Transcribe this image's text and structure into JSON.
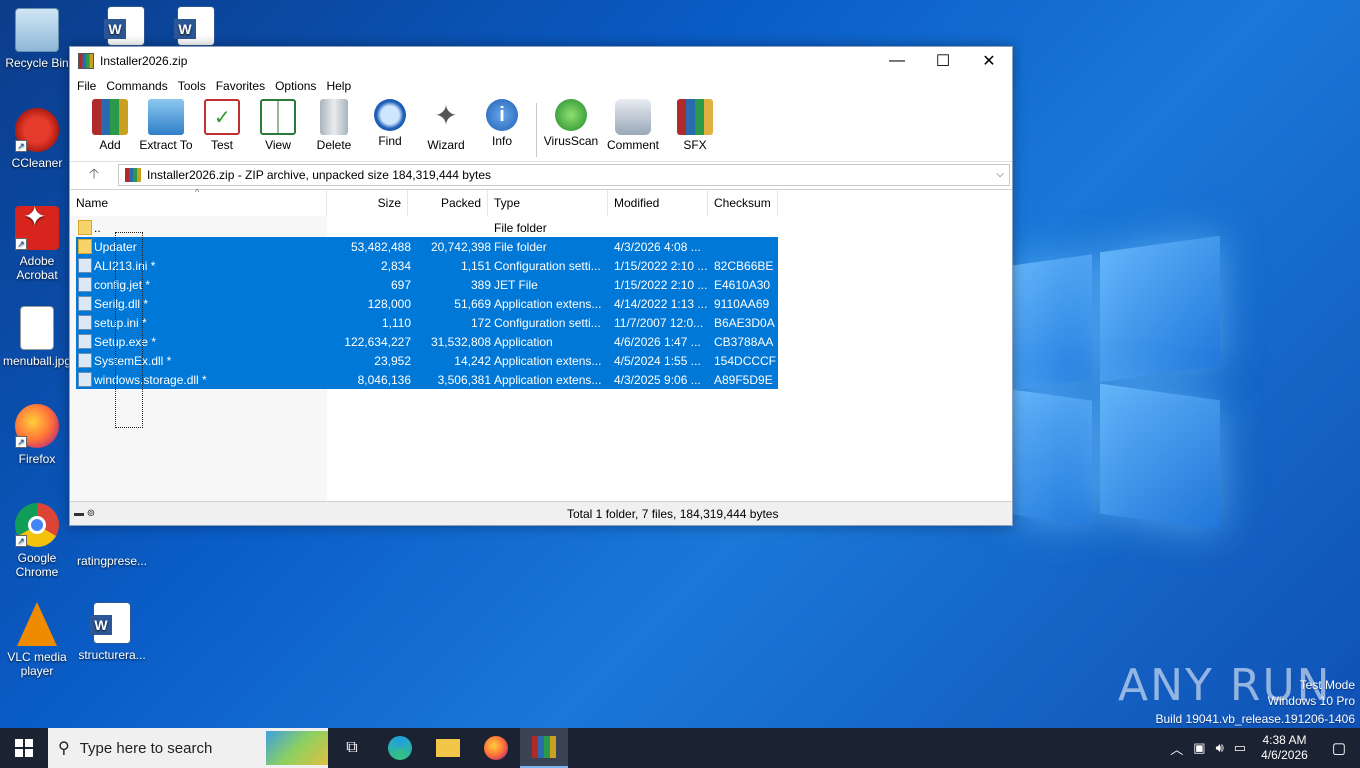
{
  "desktop": {
    "icons": [
      {
        "label": "Recycle Bin"
      },
      {
        "label": "CCleaner"
      },
      {
        "label": "Adobe Acrobat"
      },
      {
        "label": "menuball.jpg"
      },
      {
        "label": "Firefox"
      },
      {
        "label": "Google Chrome"
      },
      {
        "label": "ratingprese..."
      },
      {
        "label": "VLC media player"
      },
      {
        "label": "structurera..."
      }
    ]
  },
  "window": {
    "title": "Installer2026.zip",
    "controls": {
      "minimize": "—",
      "maximize": "☐",
      "close": "✕"
    },
    "menu": [
      "File",
      "Commands",
      "Tools",
      "Favorites",
      "Options",
      "Help"
    ],
    "toolbar": [
      "Add",
      "Extract To",
      "Test",
      "View",
      "Delete",
      "Find",
      "Wizard",
      "Info",
      "VirusScan",
      "Comment",
      "SFX"
    ],
    "address": "Installer2026.zip - ZIP archive, unpacked size 184,319,444 bytes",
    "columns": [
      "Name",
      "Size",
      "Packed",
      "Type",
      "Modified",
      "Checksum"
    ],
    "rows": [
      {
        "name": "..",
        "size": "",
        "packed": "",
        "type": "File folder",
        "modified": "",
        "checksum": "",
        "selected": false,
        "folder": true
      },
      {
        "name": "Updater",
        "size": "53,482,488",
        "packed": "20,742,398",
        "type": "File folder",
        "modified": "4/3/2026 4:08 ...",
        "checksum": "",
        "selected": true,
        "folder": true
      },
      {
        "name": "ALI213.ini *",
        "size": "2,834",
        "packed": "1,151",
        "type": "Configuration setti...",
        "modified": "1/15/2022 2:10 ...",
        "checksum": "82CB66BE",
        "selected": true,
        "folder": false
      },
      {
        "name": "config.jet *",
        "size": "697",
        "packed": "389",
        "type": "JET File",
        "modified": "1/15/2022 2:10 ...",
        "checksum": "E4610A30",
        "selected": true,
        "folder": false
      },
      {
        "name": "Serilg.dll *",
        "size": "128,000",
        "packed": "51,669",
        "type": "Application extens...",
        "modified": "4/14/2022 1:13 ...",
        "checksum": "9110AA69",
        "selected": true,
        "folder": false
      },
      {
        "name": "setup.ini *",
        "size": "1,110",
        "packed": "172",
        "type": "Configuration setti...",
        "modified": "11/7/2007 12:0...",
        "checksum": "B6AE3D0A",
        "selected": true,
        "folder": false
      },
      {
        "name": "Setup.exe *",
        "size": "122,634,227",
        "packed": "31,532,808",
        "type": "Application",
        "modified": "4/6/2026 1:47 ...",
        "checksum": "CB3788AA",
        "selected": true,
        "folder": false
      },
      {
        "name": "SystemEx.dll *",
        "size": "23,952",
        "packed": "14,242",
        "type": "Application extens...",
        "modified": "4/5/2024 1:55 ...",
        "checksum": "154DCCCF",
        "selected": true,
        "folder": false
      },
      {
        "name": "windows.storage.dll *",
        "size": "8,046,136",
        "packed": "3,506,381",
        "type": "Application extens...",
        "modified": "4/3/2025 9:06 ...",
        "checksum": "A89F5D9E",
        "selected": true,
        "folder": false
      }
    ],
    "status": "Total 1 folder, 7 files, 184,319,444 bytes"
  },
  "watermark": {
    "line1": "Test Mode",
    "line2": "Windows 10 Pro",
    "line3": "Build 19041.vb_release.191206-1406",
    "brand": "ANY RUN"
  },
  "taskbar": {
    "search_placeholder": "Type here to search",
    "time": "4:38 AM",
    "date": "4/6/2026"
  }
}
